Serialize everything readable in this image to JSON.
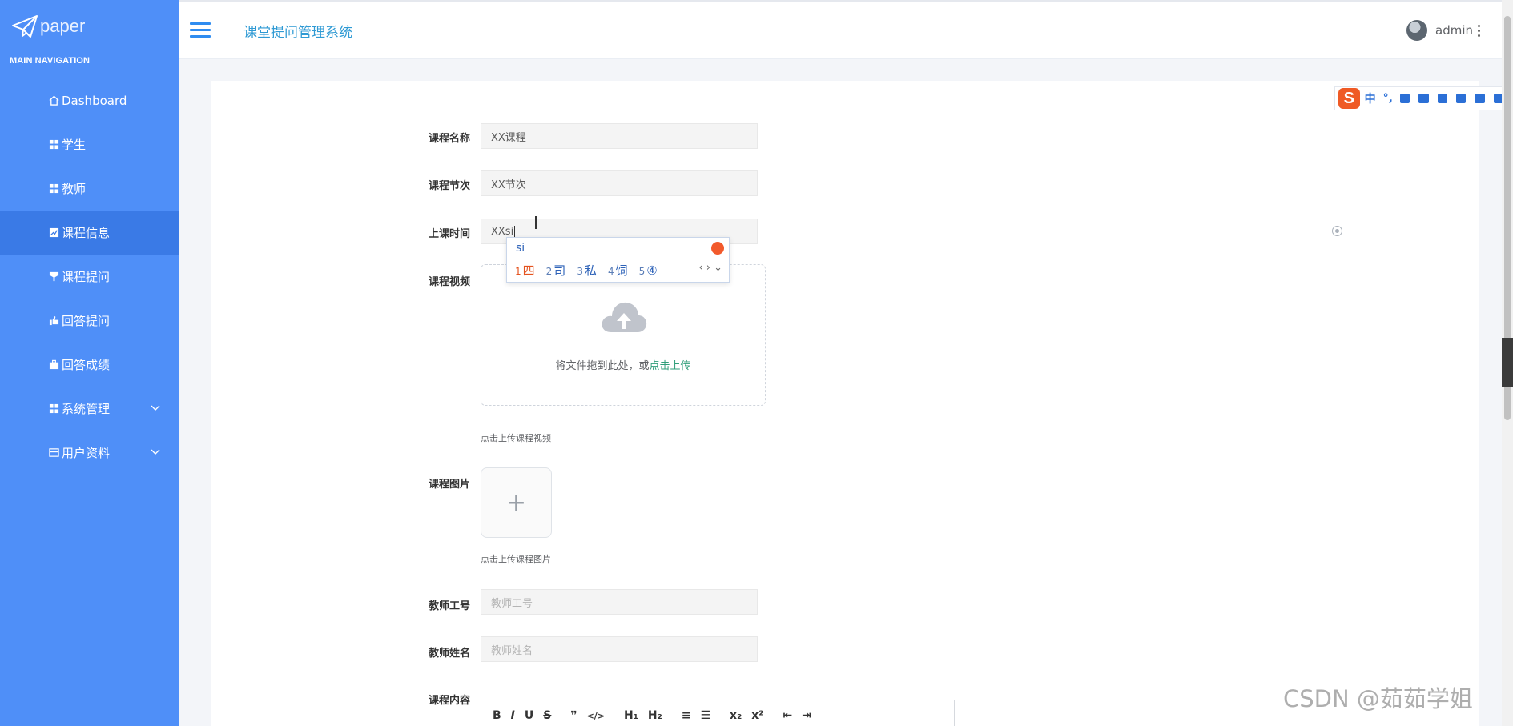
{
  "sidebar": {
    "logo_text": "paper",
    "heading": "MAIN NAVIGATION",
    "items": [
      {
        "label": "Dashboard",
        "icon": "home-icon"
      },
      {
        "label": "学生",
        "icon": "grid-icon"
      },
      {
        "label": "教师",
        "icon": "grid-icon"
      },
      {
        "label": "课程信息",
        "icon": "chart-icon",
        "active": true
      },
      {
        "label": "课程提问",
        "icon": "filter-icon"
      },
      {
        "label": "回答提问",
        "icon": "hand-icon"
      },
      {
        "label": "回答成绩",
        "icon": "briefcase-icon"
      },
      {
        "label": "系统管理",
        "icon": "grid-icon",
        "expandable": true
      },
      {
        "label": "用户资料",
        "icon": "card-icon",
        "expandable": true
      }
    ]
  },
  "header": {
    "title": "课堂提问管理系统",
    "user": "admin"
  },
  "form": {
    "course_name": {
      "label": "课程名称",
      "value": "XX课程"
    },
    "course_section": {
      "label": "课程节次",
      "value": "XX节次"
    },
    "class_time": {
      "label": "上课时间",
      "value": "XXsi"
    },
    "course_video": {
      "label": "课程视频",
      "upload_text": "将文件拖到此处，或",
      "upload_link": "点击上传",
      "tip": "点击上传课程视频"
    },
    "course_image": {
      "label": "课程图片",
      "tip": "点击上传课程图片"
    },
    "teacher_id": {
      "label": "教师工号",
      "placeholder": "教师工号"
    },
    "teacher_name": {
      "label": "教师姓名",
      "placeholder": "教师姓名"
    },
    "course_content": {
      "label": "课程内容"
    }
  },
  "editor_toolbar": [
    "B",
    "I",
    "U",
    "S",
    "❞",
    "</>",
    "H₁",
    "H₂",
    "≡",
    "☰",
    "x₂",
    "x²",
    "⇤",
    "⇥"
  ],
  "ime_popup": {
    "input": "si",
    "candidates": [
      {
        "n": "1",
        "c": "四"
      },
      {
        "n": "2",
        "c": "司"
      },
      {
        "n": "3",
        "c": "私"
      },
      {
        "n": "4",
        "c": "饲"
      },
      {
        "n": "5",
        "c": "④"
      }
    ]
  },
  "ime_toolbar": {
    "logo": "S",
    "mode": "中"
  },
  "watermark": "CSDN @茹茹学姐",
  "colors": {
    "sidebar": "#4f8ff8",
    "active": "#3a7ae6",
    "accent": "#2f9ad4",
    "link": "#2f9e7a"
  }
}
